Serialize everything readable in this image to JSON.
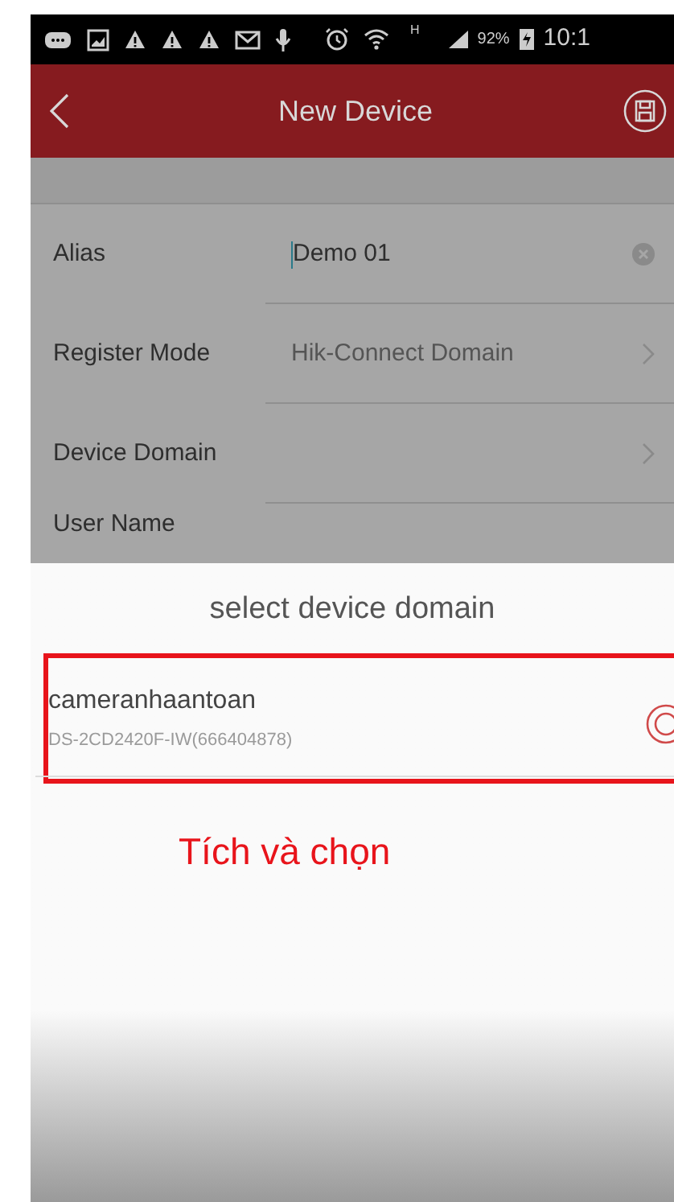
{
  "status_bar": {
    "network": "H",
    "battery": "92%",
    "time": "10:1"
  },
  "app_bar": {
    "title": "New Device"
  },
  "form": {
    "fields": [
      {
        "label": "Alias",
        "value": "Demo 01",
        "kind": "text"
      },
      {
        "label": "Register Mode",
        "value": "Hik-Connect Domain",
        "kind": "select"
      },
      {
        "label": "Device Domain",
        "kind": "select"
      },
      {
        "label": "User Name",
        "kind": "partial"
      }
    ]
  },
  "sheet": {
    "title": "select device domain",
    "items": [
      {
        "name": "cameranhaantoan",
        "detail": "DS-2CD2420F-IW(666404878)",
        "selected": true
      }
    ]
  },
  "annotation": {
    "text": "Tích và chọn"
  }
}
